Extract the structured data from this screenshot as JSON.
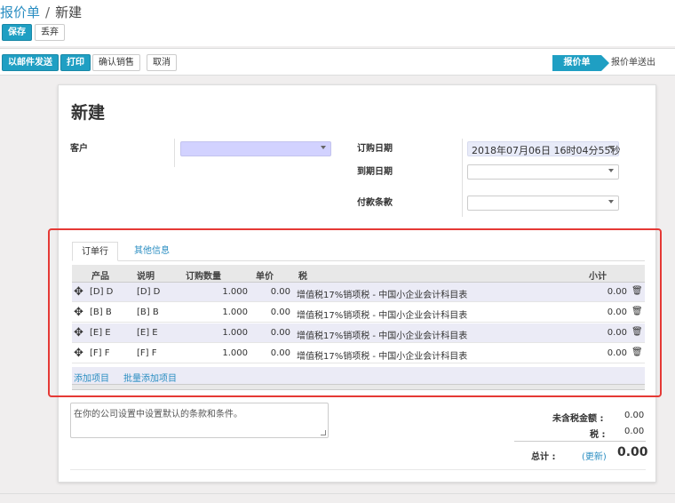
{
  "breadcrumb": {
    "parent": "报价单",
    "separator": "/",
    "current": "新建"
  },
  "control": {
    "save": "保存",
    "discard": "丢弃"
  },
  "actions": {
    "send_email": "以邮件发送",
    "print": "打印",
    "confirm_sale": "确认销售",
    "cancel": "取消"
  },
  "status": {
    "active": "报价单",
    "next": "报价单送出"
  },
  "form": {
    "title": "新建",
    "customer_label": "客户",
    "customer_value": "",
    "order_date_label": "订购日期",
    "order_date_value": "2018年07月06日 16时04分55秒",
    "expiration_label": "到期日期",
    "expiration_value": "",
    "payment_terms_label": "付款条款",
    "payment_terms_value": ""
  },
  "tabs": {
    "order_lines": "订单行",
    "other_info": "其他信息"
  },
  "grid": {
    "headers": {
      "product": "产品",
      "description": "说明",
      "qty": "订购数量",
      "price": "单价",
      "tax": "税",
      "subtotal": "小计"
    },
    "rows": [
      {
        "product": "[D] D",
        "description": "[D] D",
        "qty": "1.000",
        "price": "0.00",
        "tax": "增值税17%销项税 - 中国小企业会计科目表",
        "subtotal": "0.00"
      },
      {
        "product": "[B] B",
        "description": "[B] B",
        "qty": "1.000",
        "price": "0.00",
        "tax": "增值税17%销项税 - 中国小企业会计科目表",
        "subtotal": "0.00"
      },
      {
        "product": "[E] E",
        "description": "[E] E",
        "qty": "1.000",
        "price": "0.00",
        "tax": "增值税17%销项税 - 中国小企业会计科目表",
        "subtotal": "0.00"
      },
      {
        "product": "[F] F",
        "description": "[F] F",
        "qty": "1.000",
        "price": "0.00",
        "tax": "增值税17%销项税 - 中国小企业会计科目表",
        "subtotal": "0.00"
      }
    ],
    "add_item": "添加项目",
    "bulk_add": "批量添加项目"
  },
  "notes": {
    "placeholder": "在你的公司设置中设置默认的条款和条件。"
  },
  "totals": {
    "untaxed_label": "未含税金额 :",
    "untaxed_value": "0.00",
    "tax_label": "税 :",
    "tax_value": "0.00",
    "total_label": "总计 :",
    "update_link": "(更新)",
    "total_value": "0.00"
  },
  "colors": {
    "primary": "#1f9fc3",
    "link": "#2b8ec2",
    "highlight": "#e53935"
  },
  "icons": {
    "drag": "move-arrows-icon",
    "delete": "trash-icon",
    "dropdown": "caret-down-icon"
  }
}
